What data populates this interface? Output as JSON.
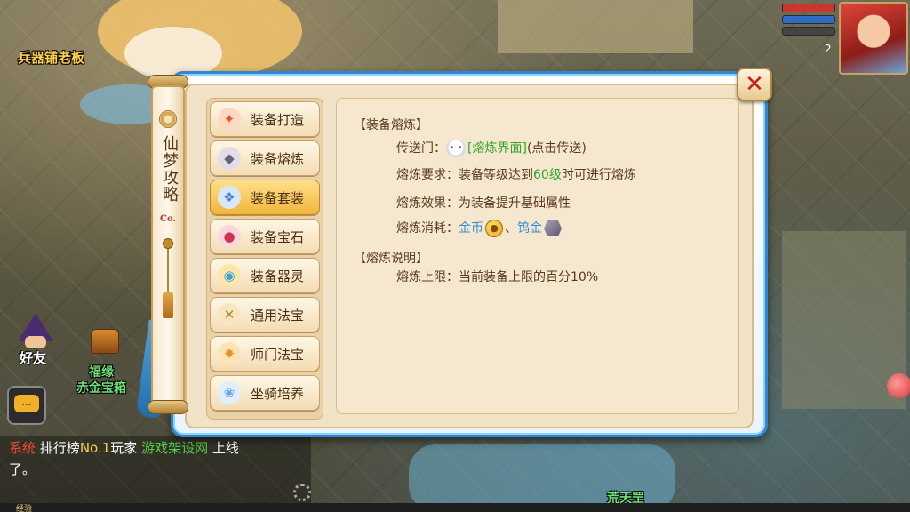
{
  "world": {
    "npc_weapon": "兵器铺老板",
    "npc_fortune": "福缘",
    "npc_chest": "赤金宝箱",
    "npc_bottom": "荒天罡",
    "friend_label": "好友",
    "level": "2",
    "exp_label": "经验"
  },
  "chat": {
    "system_tag": "系统",
    "text1": "排行榜",
    "rank": "No.1",
    "text2": "玩家",
    "player": "游戏架设网",
    "text3": "上线",
    "text4": "了。",
    "chat_icon": "..."
  },
  "scroll": {
    "title": "仙梦攻略",
    "seal": "Co."
  },
  "menu": {
    "items": [
      {
        "label": "装备打造",
        "icon": "forge-icon",
        "glyph": "✦",
        "color": "#e2572b"
      },
      {
        "label": "装备熔炼",
        "icon": "ore-icon",
        "glyph": "◆",
        "color": "#6b6478"
      },
      {
        "label": "装备套装",
        "icon": "armor-set-icon",
        "glyph": "❖",
        "color": "#4a82d6"
      },
      {
        "label": "装备宝石",
        "icon": "gem-icon",
        "glyph": "●",
        "color": "#d2334a"
      },
      {
        "label": "装备器灵",
        "icon": "spirit-icon",
        "glyph": "◉",
        "color": "#3ba0d8"
      },
      {
        "label": "通用法宝",
        "icon": "crossed-swords-icon",
        "glyph": "✕",
        "color": "#b9862a"
      },
      {
        "label": "师门法宝",
        "icon": "flame-icon",
        "glyph": "✸",
        "color": "#e69326"
      },
      {
        "label": "坐骑培养",
        "icon": "mount-icon",
        "glyph": "❀",
        "color": "#6aa7e4"
      }
    ],
    "active_index": 2
  },
  "content": {
    "section1_title": "【装备熔炼】",
    "portal_label": "传送门：",
    "portal_link": "[熔炼界面]",
    "portal_hint": "(点击传送)",
    "req_label": "熔炼要求：",
    "req_text1": "装备等级达到",
    "req_level": "60级",
    "req_text2": "时可进行熔炼",
    "effect_label": "熔炼效果：",
    "effect_text": "为装备提升基础属性",
    "cost_label": "熔炼消耗：",
    "cost_gold": "金币",
    "cost_sep": "、",
    "cost_tungsten": "钨金",
    "section2_title": "【熔炼说明】",
    "limit_label": "熔炼上限：",
    "limit_text": "当前装备上限的百分10%"
  },
  "colors": {
    "frame_blue": "#2f87cf",
    "parchment": "#f3e3c6",
    "link_green": "#2fa52b",
    "link_blue": "#2c8ed8",
    "close_red": "#c21f1f"
  }
}
